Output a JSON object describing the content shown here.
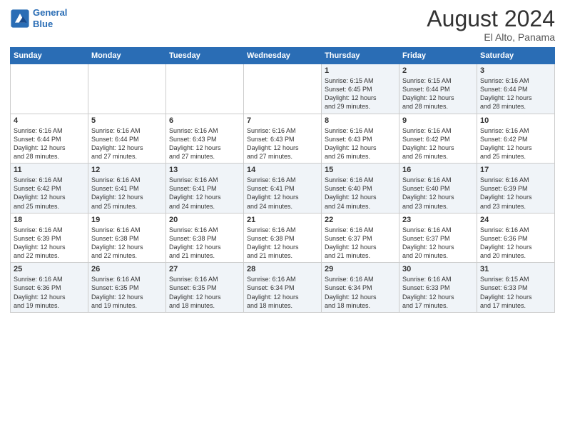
{
  "header": {
    "logo_line1": "General",
    "logo_line2": "Blue",
    "month": "August 2024",
    "location": "El Alto, Panama"
  },
  "days_of_week": [
    "Sunday",
    "Monday",
    "Tuesday",
    "Wednesday",
    "Thursday",
    "Friday",
    "Saturday"
  ],
  "weeks": [
    [
      {
        "day": "",
        "info": ""
      },
      {
        "day": "",
        "info": ""
      },
      {
        "day": "",
        "info": ""
      },
      {
        "day": "",
        "info": ""
      },
      {
        "day": "1",
        "info": "Sunrise: 6:15 AM\nSunset: 6:45 PM\nDaylight: 12 hours\nand 29 minutes."
      },
      {
        "day": "2",
        "info": "Sunrise: 6:15 AM\nSunset: 6:44 PM\nDaylight: 12 hours\nand 28 minutes."
      },
      {
        "day": "3",
        "info": "Sunrise: 6:16 AM\nSunset: 6:44 PM\nDaylight: 12 hours\nand 28 minutes."
      }
    ],
    [
      {
        "day": "4",
        "info": "Sunrise: 6:16 AM\nSunset: 6:44 PM\nDaylight: 12 hours\nand 28 minutes."
      },
      {
        "day": "5",
        "info": "Sunrise: 6:16 AM\nSunset: 6:44 PM\nDaylight: 12 hours\nand 27 minutes."
      },
      {
        "day": "6",
        "info": "Sunrise: 6:16 AM\nSunset: 6:43 PM\nDaylight: 12 hours\nand 27 minutes."
      },
      {
        "day": "7",
        "info": "Sunrise: 6:16 AM\nSunset: 6:43 PM\nDaylight: 12 hours\nand 27 minutes."
      },
      {
        "day": "8",
        "info": "Sunrise: 6:16 AM\nSunset: 6:43 PM\nDaylight: 12 hours\nand 26 minutes."
      },
      {
        "day": "9",
        "info": "Sunrise: 6:16 AM\nSunset: 6:42 PM\nDaylight: 12 hours\nand 26 minutes."
      },
      {
        "day": "10",
        "info": "Sunrise: 6:16 AM\nSunset: 6:42 PM\nDaylight: 12 hours\nand 25 minutes."
      }
    ],
    [
      {
        "day": "11",
        "info": "Sunrise: 6:16 AM\nSunset: 6:42 PM\nDaylight: 12 hours\nand 25 minutes."
      },
      {
        "day": "12",
        "info": "Sunrise: 6:16 AM\nSunset: 6:41 PM\nDaylight: 12 hours\nand 25 minutes."
      },
      {
        "day": "13",
        "info": "Sunrise: 6:16 AM\nSunset: 6:41 PM\nDaylight: 12 hours\nand 24 minutes."
      },
      {
        "day": "14",
        "info": "Sunrise: 6:16 AM\nSunset: 6:41 PM\nDaylight: 12 hours\nand 24 minutes."
      },
      {
        "day": "15",
        "info": "Sunrise: 6:16 AM\nSunset: 6:40 PM\nDaylight: 12 hours\nand 24 minutes."
      },
      {
        "day": "16",
        "info": "Sunrise: 6:16 AM\nSunset: 6:40 PM\nDaylight: 12 hours\nand 23 minutes."
      },
      {
        "day": "17",
        "info": "Sunrise: 6:16 AM\nSunset: 6:39 PM\nDaylight: 12 hours\nand 23 minutes."
      }
    ],
    [
      {
        "day": "18",
        "info": "Sunrise: 6:16 AM\nSunset: 6:39 PM\nDaylight: 12 hours\nand 22 minutes."
      },
      {
        "day": "19",
        "info": "Sunrise: 6:16 AM\nSunset: 6:38 PM\nDaylight: 12 hours\nand 22 minutes."
      },
      {
        "day": "20",
        "info": "Sunrise: 6:16 AM\nSunset: 6:38 PM\nDaylight: 12 hours\nand 21 minutes."
      },
      {
        "day": "21",
        "info": "Sunrise: 6:16 AM\nSunset: 6:38 PM\nDaylight: 12 hours\nand 21 minutes."
      },
      {
        "day": "22",
        "info": "Sunrise: 6:16 AM\nSunset: 6:37 PM\nDaylight: 12 hours\nand 21 minutes."
      },
      {
        "day": "23",
        "info": "Sunrise: 6:16 AM\nSunset: 6:37 PM\nDaylight: 12 hours\nand 20 minutes."
      },
      {
        "day": "24",
        "info": "Sunrise: 6:16 AM\nSunset: 6:36 PM\nDaylight: 12 hours\nand 20 minutes."
      }
    ],
    [
      {
        "day": "25",
        "info": "Sunrise: 6:16 AM\nSunset: 6:36 PM\nDaylight: 12 hours\nand 19 minutes."
      },
      {
        "day": "26",
        "info": "Sunrise: 6:16 AM\nSunset: 6:35 PM\nDaylight: 12 hours\nand 19 minutes."
      },
      {
        "day": "27",
        "info": "Sunrise: 6:16 AM\nSunset: 6:35 PM\nDaylight: 12 hours\nand 18 minutes."
      },
      {
        "day": "28",
        "info": "Sunrise: 6:16 AM\nSunset: 6:34 PM\nDaylight: 12 hours\nand 18 minutes."
      },
      {
        "day": "29",
        "info": "Sunrise: 6:16 AM\nSunset: 6:34 PM\nDaylight: 12 hours\nand 18 minutes."
      },
      {
        "day": "30",
        "info": "Sunrise: 6:16 AM\nSunset: 6:33 PM\nDaylight: 12 hours\nand 17 minutes."
      },
      {
        "day": "31",
        "info": "Sunrise: 6:15 AM\nSunset: 6:33 PM\nDaylight: 12 hours\nand 17 minutes."
      }
    ]
  ]
}
